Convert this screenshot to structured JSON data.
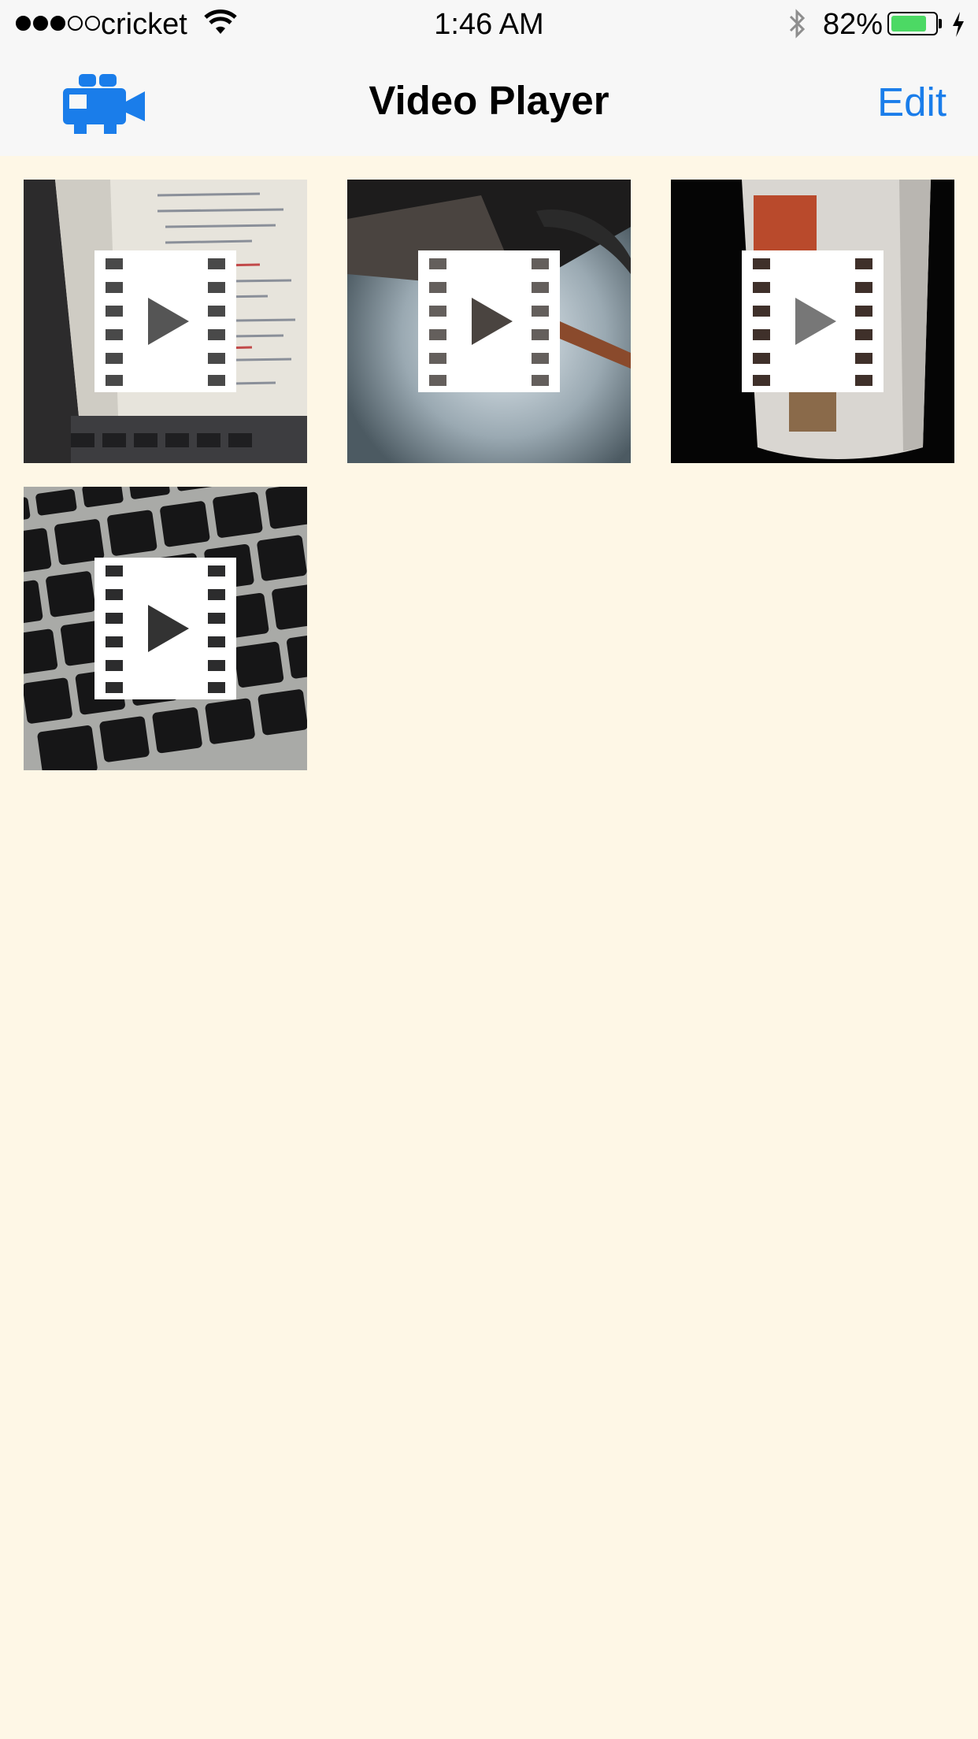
{
  "status_bar": {
    "carrier": "cricket",
    "signal_bars_filled": 3,
    "signal_bars_total": 5,
    "time": "1:46 AM",
    "battery_percent": "82%",
    "battery_level": 0.82,
    "charging": true,
    "bluetooth": true
  },
  "nav": {
    "title": "Video Player",
    "left_icon": "video-camera-icon",
    "right_label": "Edit"
  },
  "colors": {
    "accent": "#1a7dea",
    "background": "#fef7e6",
    "nav_background": "#f7f7f7",
    "battery_green": "#4cd964"
  },
  "videos": [
    {
      "thumbnail": "laptop-screen-code",
      "overlay_icon": "film-play-icon"
    },
    {
      "thumbnail": "desk-lamp",
      "overlay_icon": "film-play-icon"
    },
    {
      "thumbnail": "coffee-mug",
      "overlay_icon": "film-play-icon"
    },
    {
      "thumbnail": "keyboard",
      "overlay_icon": "film-play-icon"
    }
  ]
}
